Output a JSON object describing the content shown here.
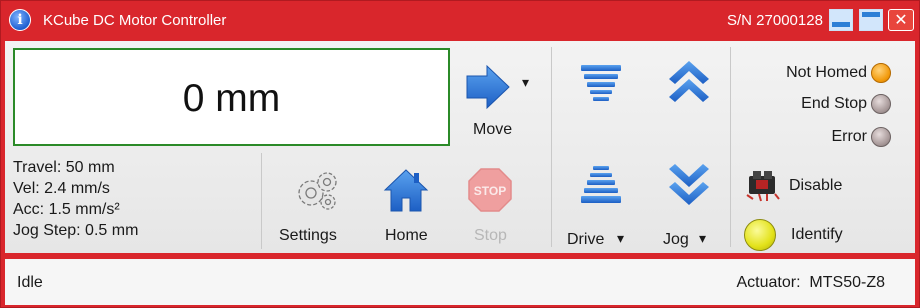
{
  "window": {
    "title": "KCube DC Motor Controller",
    "serial": "S/N 27000128",
    "close_glyph": "✕",
    "info_glyph": "i"
  },
  "display": {
    "position": "0 mm"
  },
  "info": {
    "travel": "Travel: 50 mm",
    "vel": "Vel: 2.4 mm/s",
    "acc": "Acc: 1.5 mm/s²",
    "jog_step": "Jog Step: 0.5 mm"
  },
  "buttons": {
    "move": "Move",
    "settings": "Settings",
    "home": "Home",
    "stop": "Stop",
    "stop_sign": "STOP",
    "drive": "Drive",
    "jog": "Jog",
    "disable": "Disable",
    "identify": "Identify",
    "dropdown_glyph": "▾"
  },
  "status_indicators": [
    {
      "label": "Not Homed",
      "state": "orange"
    },
    {
      "label": "End Stop",
      "state": "off"
    },
    {
      "label": "Error",
      "state": "off"
    }
  ],
  "statusbar": {
    "state": "Idle",
    "actuator_label": "Actuator:",
    "actuator_value": "MTS50-Z8"
  },
  "colors": {
    "frame_red": "#d9262c",
    "display_border_green": "#2b8a28",
    "icon_blue": "#2a74d5",
    "led_orange": "#f29a0b",
    "identify_yellow": "#e3e21a"
  },
  "icons": {
    "app": "info-icon",
    "move": "arrow-right-icon",
    "settings": "gears-icon",
    "home": "house-icon",
    "stop": "stop-sign-icon",
    "drive_up": "stack-up-icon",
    "drive_down": "stack-down-icon",
    "jog_up": "double-chevron-up-icon",
    "jog_down": "double-chevron-down-icon",
    "disable": "relay-icon"
  }
}
